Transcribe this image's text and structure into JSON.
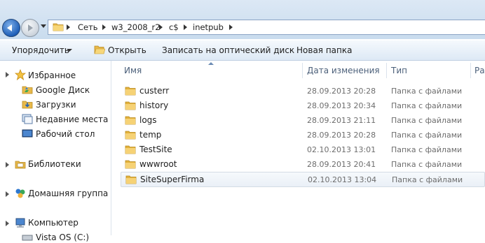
{
  "address": {
    "crumbs": [
      "Сеть",
      "w3_2008_r2",
      "c$",
      "inetpub"
    ]
  },
  "toolbar": {
    "organize": "Упорядочить",
    "open": "Открыть",
    "burn": "Записать на оптический диск",
    "new_folder": "Новая папка"
  },
  "nav": {
    "favorites": "Избранное",
    "google_drive": "Google Диск",
    "downloads": "Загрузки",
    "recent": "Недавние места",
    "desktop": "Рабочий стол",
    "libraries": "Библиотеки",
    "homegroup": "Домашняя группа",
    "computer": "Компьютер",
    "drive_c": "Vista OS (C:)"
  },
  "columns": {
    "name": "Имя",
    "date": "Дата изменения",
    "type": "Тип",
    "size": "Ра"
  },
  "files": [
    {
      "name": "custerr",
      "date": "28.09.2013 20:28",
      "type": "Папка с файлами"
    },
    {
      "name": "history",
      "date": "28.09.2013 20:34",
      "type": "Папка с файлами"
    },
    {
      "name": "logs",
      "date": "28.09.2013 21:11",
      "type": "Папка с файлами"
    },
    {
      "name": "temp",
      "date": "28.09.2013 20:28",
      "type": "Папка с файлами"
    },
    {
      "name": "TestSite",
      "date": "02.10.2013 13:01",
      "type": "Папка с файлами"
    },
    {
      "name": "wwwroot",
      "date": "28.09.2013 20:41",
      "type": "Папка с файлами"
    },
    {
      "name": "SiteSuperFirma",
      "date": "02.10.2013 13:04",
      "type": "Папка с файлами"
    }
  ],
  "icons": {
    "folder": "folder-icon",
    "star": "star-icon",
    "library": "library-icon",
    "homegroup": "homegroup-icon",
    "computer": "computer-icon"
  }
}
